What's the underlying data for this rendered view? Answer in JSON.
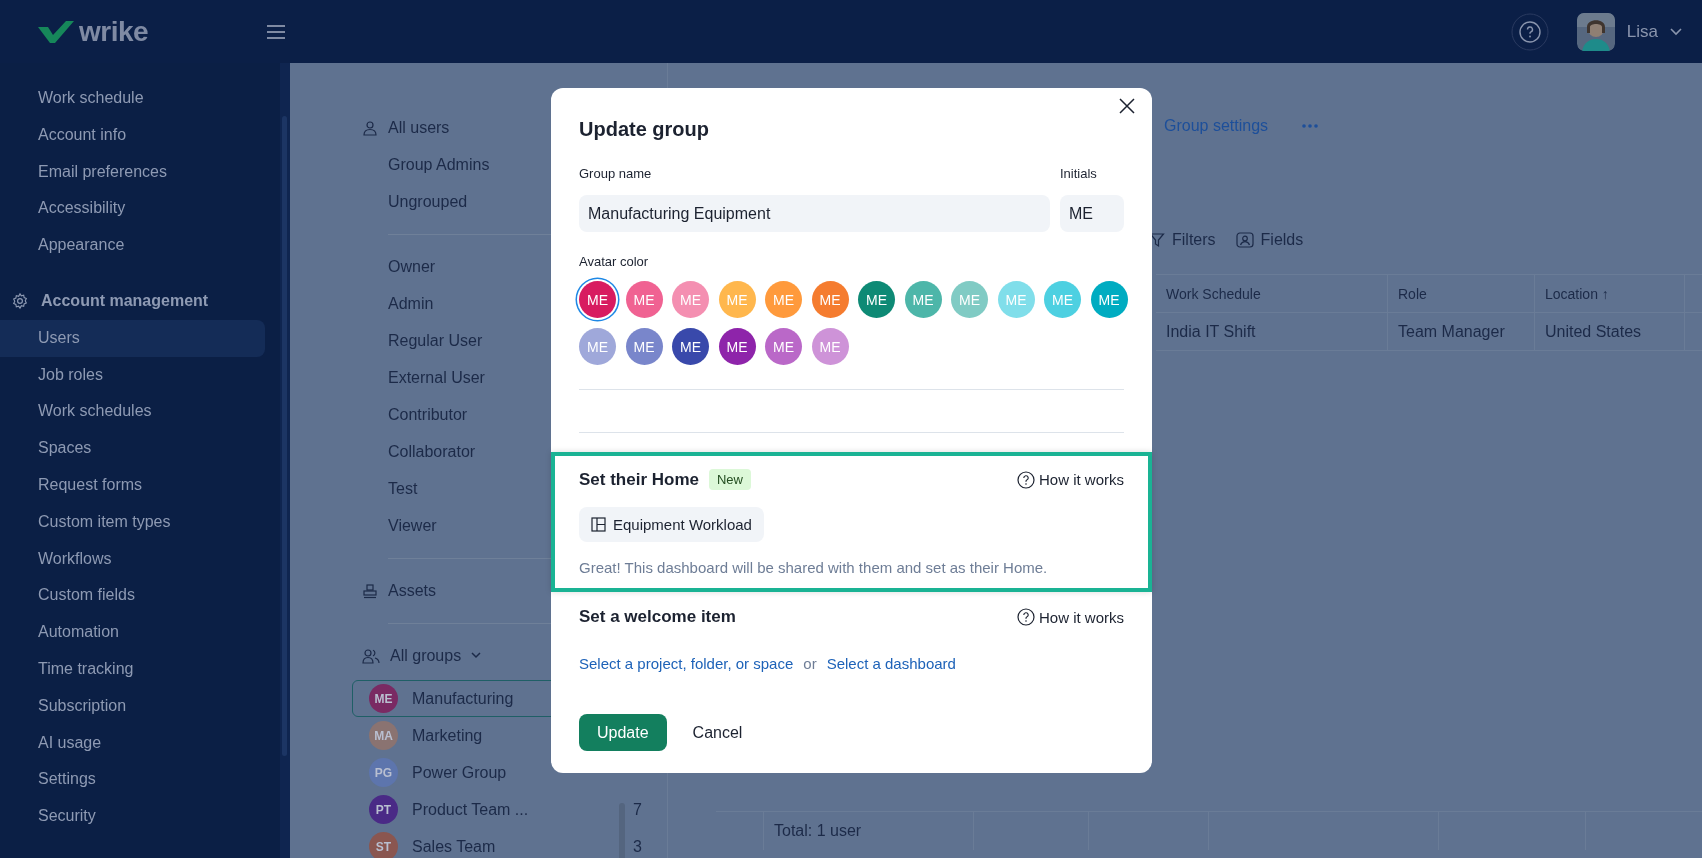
{
  "header": {
    "logo": "wrike",
    "user_name": "Lisa"
  },
  "sidebar": {
    "items": [
      {
        "label": "Work schedule",
        "kind": "item",
        "selected": false
      },
      {
        "label": "Account info",
        "kind": "item",
        "selected": false
      },
      {
        "label": "Email preferences",
        "kind": "item",
        "selected": false
      },
      {
        "label": "Accessibility",
        "kind": "item",
        "selected": false
      },
      {
        "label": "Appearance",
        "kind": "item",
        "selected": false
      },
      {
        "label": "Account management",
        "kind": "section",
        "selected": false
      },
      {
        "label": "Users",
        "kind": "item",
        "selected": true
      },
      {
        "label": "Job roles",
        "kind": "item",
        "selected": false
      },
      {
        "label": "Work schedules",
        "kind": "item",
        "selected": false
      },
      {
        "label": "Spaces",
        "kind": "item",
        "selected": false
      },
      {
        "label": "Request forms",
        "kind": "item",
        "selected": false
      },
      {
        "label": "Custom item types",
        "kind": "item",
        "selected": false
      },
      {
        "label": "Workflows",
        "kind": "item",
        "selected": false
      },
      {
        "label": "Custom fields",
        "kind": "item",
        "selected": false
      },
      {
        "label": "Automation",
        "kind": "item",
        "selected": false
      },
      {
        "label": "Time tracking",
        "kind": "item",
        "selected": false
      },
      {
        "label": "Subscription",
        "kind": "item",
        "selected": false
      },
      {
        "label": "AI usage",
        "kind": "item",
        "selected": false
      },
      {
        "label": "Settings",
        "kind": "item",
        "selected": false
      },
      {
        "label": "Security",
        "kind": "item",
        "selected": false
      }
    ]
  },
  "user_filters": {
    "sections": [
      [
        {
          "label": "All users",
          "kind": "users"
        },
        {
          "label": "Group Admins",
          "kind": "plain"
        },
        {
          "label": "Ungrouped",
          "kind": "plain"
        }
      ],
      [
        {
          "label": "Owner",
          "kind": "plain"
        },
        {
          "label": "Admin",
          "kind": "plain"
        },
        {
          "label": "Regular User",
          "kind": "plain"
        },
        {
          "label": "External User",
          "kind": "plain"
        },
        {
          "label": "Contributor",
          "kind": "plain"
        },
        {
          "label": "Collaborator",
          "kind": "plain"
        },
        {
          "label": "Test",
          "kind": "plain"
        },
        {
          "label": "Viewer",
          "kind": "plain"
        }
      ],
      [
        {
          "label": "Assets",
          "kind": "assets"
        }
      ]
    ],
    "groups_heading": "All groups",
    "groups": [
      {
        "initials": "ME",
        "name": "Manufacturing",
        "color": "#7a2a63",
        "selected": true
      },
      {
        "initials": "MA",
        "name": "Marketing",
        "color": "#8a7371",
        "selected": false
      },
      {
        "initials": "PG",
        "name": "Power Group",
        "color": "#5d75ad",
        "selected": false
      },
      {
        "initials": "PT",
        "name": "Product Team ...",
        "count": "7",
        "color": "#4a2a86",
        "selected": false
      },
      {
        "initials": "ST",
        "name": "Sales Team",
        "count": "3",
        "color": "#8a5650",
        "selected": false
      }
    ]
  },
  "toolbar": {
    "group_settings": "Group settings",
    "filters": "Filters",
    "fields": "Fields"
  },
  "table": {
    "columns": [
      "Work Schedule",
      "Role",
      "Location ↑"
    ],
    "rows": [
      [
        "India IT Shift",
        "Team Manager",
        "United States"
      ]
    ],
    "footer": "Total: 1 user"
  },
  "dialog": {
    "title": "Update group",
    "name_label": "Group name",
    "name_value": "Manufacturing Equipment",
    "initials_label": "Initials",
    "initials_value": "ME",
    "avatar_label": "Avatar color",
    "avatar_colors": [
      {
        "label": "ME",
        "color": "#d81b60",
        "selected": true
      },
      {
        "label": "ME",
        "color": "#f06292",
        "selected": false
      },
      {
        "label": "ME",
        "color": "#f48fb1",
        "selected": false
      },
      {
        "label": "ME",
        "color": "#ffb74d",
        "selected": false
      },
      {
        "label": "ME",
        "color": "#ff9a3c",
        "selected": false
      },
      {
        "label": "ME",
        "color": "#f57c2f",
        "selected": false
      },
      {
        "label": "ME",
        "color": "#0e8a75",
        "selected": false
      },
      {
        "label": "ME",
        "color": "#4db6a9",
        "selected": false
      },
      {
        "label": "ME",
        "color": "#80cbc4",
        "selected": false
      },
      {
        "label": "ME",
        "color": "#80deea",
        "selected": false
      },
      {
        "label": "ME",
        "color": "#4dd0e1",
        "selected": false
      },
      {
        "label": "ME",
        "color": "#00acc1",
        "selected": false
      },
      {
        "label": "ME",
        "color": "#9fa8da",
        "selected": false
      },
      {
        "label": "ME",
        "color": "#7986cb",
        "selected": false
      },
      {
        "label": "ME",
        "color": "#3949ab",
        "selected": false
      },
      {
        "label": "ME",
        "color": "#8e24aa",
        "selected": false
      },
      {
        "label": "ME",
        "color": "#ba68c8",
        "selected": false
      },
      {
        "label": "ME",
        "color": "#ce93d8",
        "selected": false
      }
    ],
    "home": {
      "title": "Set their Home",
      "badge": "New",
      "help": "How it works",
      "dashboard": "Equipment Workload",
      "note": "Great! This dashboard will be shared with them and set as their Home."
    },
    "welcome": {
      "title": "Set a welcome item",
      "help": "How it works",
      "link_1": "Select a project, folder, or space",
      "or": "or",
      "link_2": "Select a dashboard"
    },
    "buttons": {
      "primary": "Update",
      "secondary": "Cancel"
    }
  }
}
